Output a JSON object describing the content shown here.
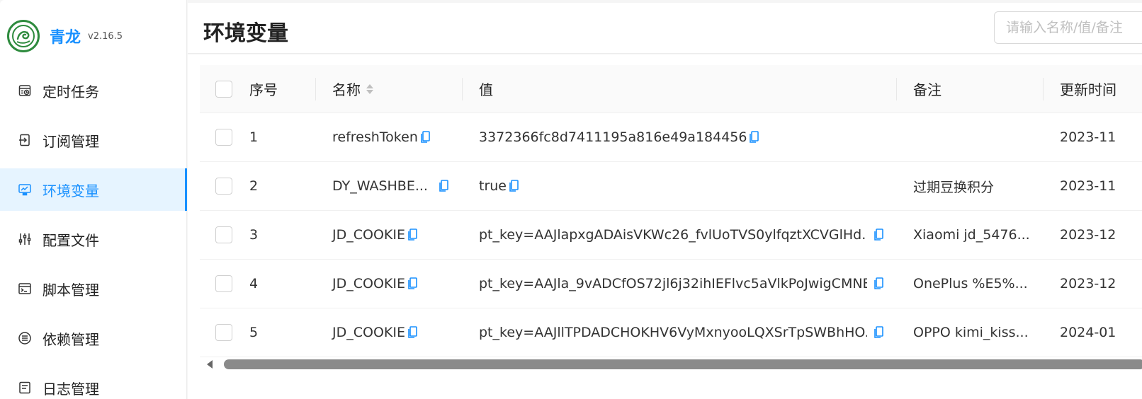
{
  "app": {
    "title": "青龙",
    "version": "v2.16.5"
  },
  "sidebar": {
    "items": [
      {
        "label": "定时任务",
        "icon": "clock-task-icon"
      },
      {
        "label": "订阅管理",
        "icon": "subscription-icon"
      },
      {
        "label": "环境变量",
        "icon": "monitor-icon",
        "active": true
      },
      {
        "label": "配置文件",
        "icon": "sliders-icon"
      },
      {
        "label": "脚本管理",
        "icon": "terminal-icon"
      },
      {
        "label": "依赖管理",
        "icon": "list-circle-icon"
      },
      {
        "label": "日志管理",
        "icon": "log-icon"
      }
    ]
  },
  "header": {
    "title": "环境变量",
    "search_placeholder": "请输入名称/值/备注"
  },
  "table": {
    "columns": {
      "index": "序号",
      "name": "名称",
      "value": "值",
      "remark": "备注",
      "updated": "更新时间"
    },
    "rows": [
      {
        "index": "1",
        "name": "refreshToken",
        "value": "3372366fc8d7411195a816e49a184456",
        "remark": "",
        "updated": "2023-11"
      },
      {
        "index": "2",
        "name": "DY_WASHBE...",
        "value": "true",
        "remark": "过期豆换积分",
        "updated": "2023-11"
      },
      {
        "index": "3",
        "name": "JD_COOKIE",
        "value": "pt_key=AAJlapxgADAisVKWc26_fvlUoTVS0ylfqztXCVGlHd...",
        "remark": "Xiaomi jd_5476...",
        "updated": "2023-12"
      },
      {
        "index": "4",
        "name": "JD_COOKIE",
        "value": "pt_key=AAJla_9vADCfOS72jl6j32ihIEFlvc5aVlkPoJwigCMNE...",
        "remark": "OnePlus %E5%...",
        "updated": "2023-12"
      },
      {
        "index": "5",
        "name": "JD_COOKIE",
        "value": "pt_key=AAJllTPDADCHOKHV6VyMxnyooLQXSrTpSWBhHO...",
        "remark": "OPPO kimi_kiss...",
        "updated": "2024-01"
      }
    ]
  },
  "colors": {
    "accent": "#1890ff",
    "active_bg": "#e6f4ff",
    "logo_green": "#2e8b3e"
  }
}
